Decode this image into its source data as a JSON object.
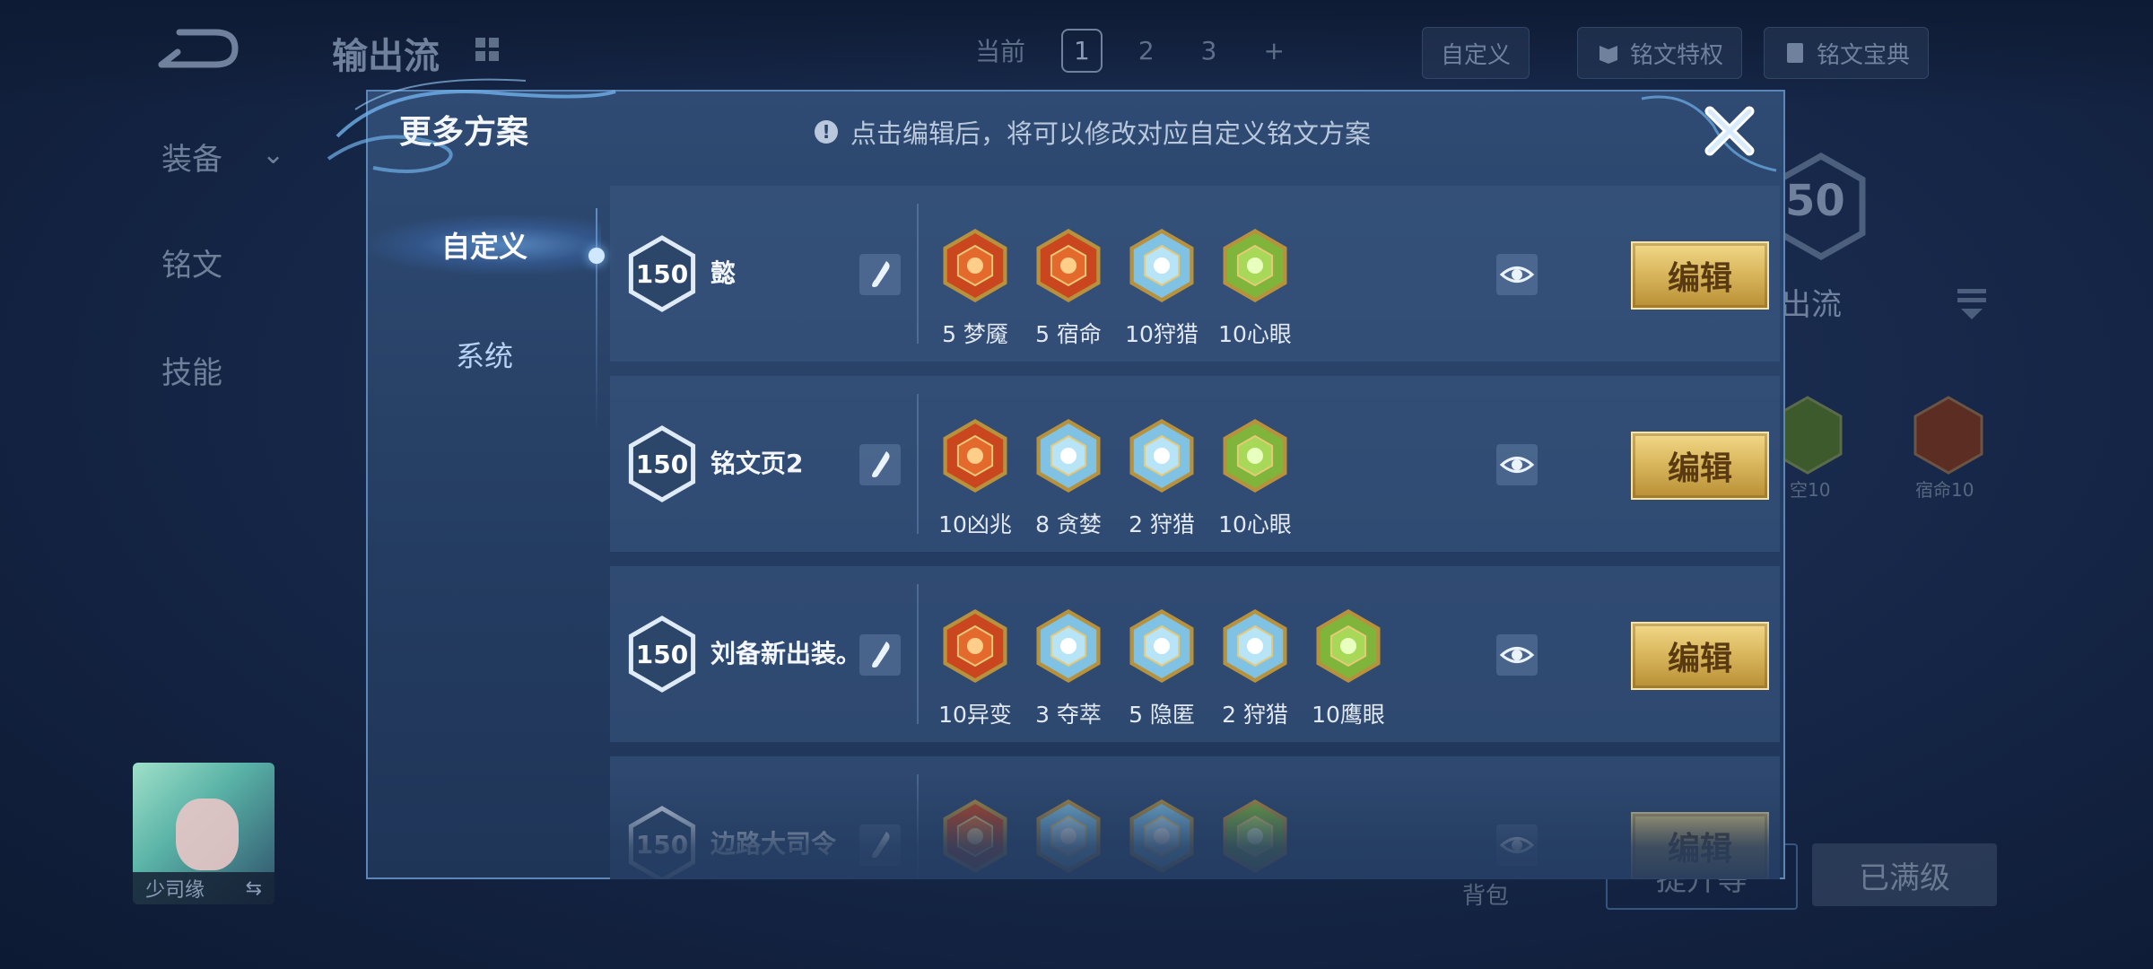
{
  "background": {
    "title": "输出流",
    "side_items": [
      "装备",
      "铭文",
      "技能"
    ],
    "page_label": "当前",
    "pages": [
      "1",
      "2",
      "3",
      "+"
    ],
    "custom_pill": "自定义",
    "privilege_pill": "铭文特权",
    "codex_pill": "铭文宝典",
    "level": "50",
    "right_label": "出流",
    "rune_labels": [
      "空10",
      "宿命10"
    ],
    "hero_name": "少司缘",
    "swap_icon": "⇆",
    "backpack": "背包",
    "btn_left": "提升等",
    "btn_right": "已满级"
  },
  "modal": {
    "title": "更多方案",
    "hint": "点击编辑后，将可以修改对应自定义铭文方案",
    "tabs": [
      "自定义",
      "系统"
    ],
    "edit_label": "编辑",
    "plans": [
      {
        "level": "150",
        "name": "懿",
        "runes": [
          {
            "label": "5 梦魇",
            "color": "red",
            "icon": "mask-rune-icon"
          },
          {
            "label": "5 宿命",
            "color": "red",
            "icon": "flame-rune-icon"
          },
          {
            "label": "10狩猎",
            "color": "blue",
            "icon": "lightning-rune-icon"
          },
          {
            "label": "10心眼",
            "color": "green",
            "icon": "leaf-rune-icon"
          }
        ]
      },
      {
        "level": "150",
        "name": "铭文页2",
        "runes": [
          {
            "label": "10凶兆",
            "color": "red",
            "icon": "omen-rune-icon"
          },
          {
            "label": "8 贪婪",
            "color": "blue",
            "icon": "star-rune-icon"
          },
          {
            "label": "2 狩猎",
            "color": "blue",
            "icon": "lightning-rune-icon"
          },
          {
            "label": "10心眼",
            "color": "green",
            "icon": "leaf-rune-icon"
          }
        ]
      },
      {
        "level": "150",
        "name": "刘备新出装。",
        "runes": [
          {
            "label": "10异变",
            "color": "red",
            "icon": "mutation-rune-icon"
          },
          {
            "label": "3 夺萃",
            "color": "blue",
            "icon": "triquetra-rune-icon"
          },
          {
            "label": "5 隐匿",
            "color": "blue",
            "icon": "drop-rune-icon"
          },
          {
            "label": "2 狩猎",
            "color": "blue",
            "icon": "lightning-rune-icon"
          },
          {
            "label": "10鹰眼",
            "color": "green",
            "icon": "gear-rune-icon"
          }
        ]
      },
      {
        "level": "150",
        "name": "边路大司令",
        "runes": [
          {
            "label": "",
            "color": "red",
            "icon": "mask-rune-icon"
          },
          {
            "label": "",
            "color": "blue",
            "icon": "triquetra-rune-icon"
          },
          {
            "label": "",
            "color": "blue",
            "icon": "lightning-rune-icon"
          },
          {
            "label": "",
            "color": "green",
            "icon": "leaf-rune-icon"
          }
        ]
      }
    ]
  },
  "colors": {
    "rune_red": "#c9461f",
    "rune_blue": "#7fc2e4",
    "rune_green": "#7eb53a",
    "gold": "#d7b45a"
  }
}
